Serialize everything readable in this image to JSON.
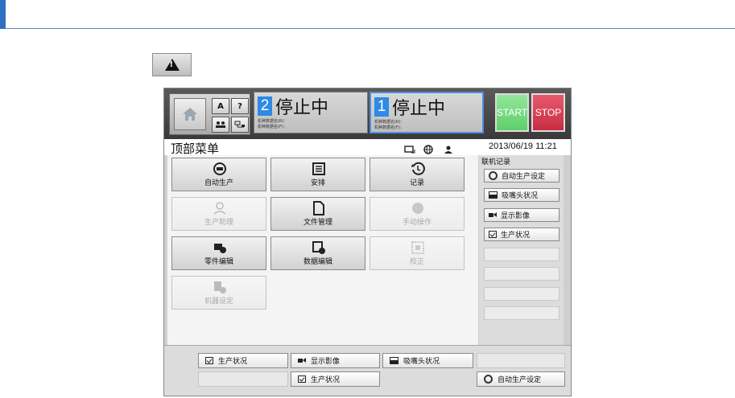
{
  "panel": {
    "status_left": {
      "number": "2",
      "text": "停止中",
      "sub1": "机种数据名(R)：",
      "sub2": "机种数据名(F)："
    },
    "status_right": {
      "number": "1",
      "text": "停止中",
      "sub1": "机种数据名(R)：",
      "sub2": "机种数据名(F)："
    },
    "start_label": "START",
    "stop_label": "STOP",
    "title": "顶部菜单",
    "datetime": "2013/06/19 11:21",
    "header_small": {
      "auto_label": "A",
      "help_label": "?"
    }
  },
  "menu": {
    "auto_production": "自动生产",
    "schedule": "安排",
    "record": "记录",
    "production_assist": "生产助理",
    "file_management": "文件管理",
    "manual_operation": "手动操作",
    "part_edit": "零件编辑",
    "data_edit": "数据编辑",
    "calibration": "校正",
    "machine_settings": "机器设定"
  },
  "online_log": {
    "heading": "联机记录",
    "items": [
      "自动生产设定",
      "吸嘴头状况",
      "显示影像",
      "生产状况"
    ]
  },
  "bottom": {
    "row1": [
      "生产状况",
      "显示影像",
      "吸嘴头状况"
    ],
    "row2_mid": "生产状况",
    "row2_right": "自动生产设定"
  },
  "colors": {
    "accent_blue": "#2d8ae6",
    "start_green": "#5fcf6b",
    "stop_red": "#c72c42"
  }
}
